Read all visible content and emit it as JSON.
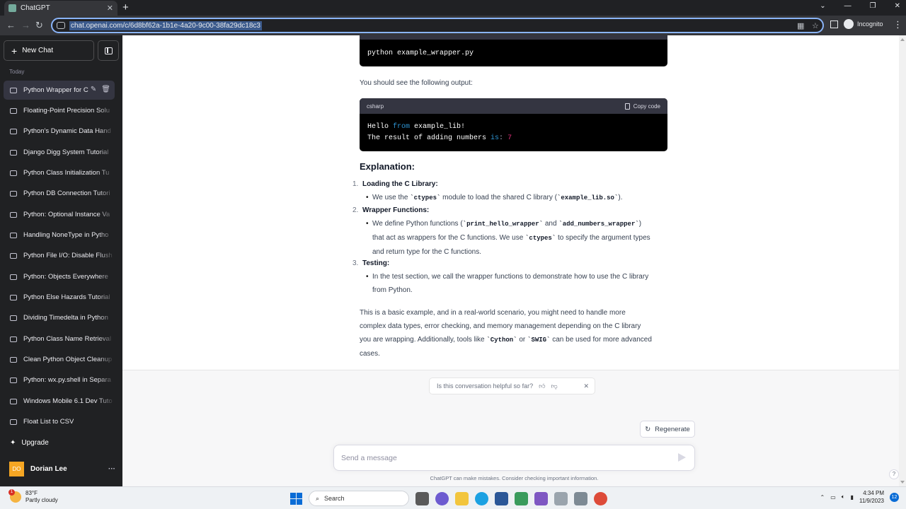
{
  "browser": {
    "tab_title": "ChatGPT",
    "url": "chat.openai.com/c/6d8bf62a-1b1e-4a20-9c00-38fa29dc18c3",
    "profile_label": "Incognito"
  },
  "sidebar": {
    "new_chat": "New Chat",
    "section_label": "Today",
    "conversations": [
      "Python Wrapper for C",
      "Floating-Point Precision Solu",
      "Python's Dynamic Data Hand",
      "Django Digg System Tutorial",
      "Python Class Initialization Tu",
      "Python DB Connection Tutori",
      "Python: Optional Instance Va",
      "Handling NoneType in Pytho",
      "Python File I/O: Disable Flush",
      "Python: Objects Everywhere",
      "Python Else Hazards Tutorial",
      "Dividing Timedelta in Python",
      "Python Class Name Retrieval",
      "Clean Python Object Cleanup",
      "Python: wx.py.shell in Separa",
      "Windows Mobile 6.1 Dev Tuto",
      "Float List to CSV"
    ],
    "upgrade": "Upgrade",
    "user_initials": "DO",
    "user_name": "Dorian Lee"
  },
  "content": {
    "run_command": "python example_wrapper.py",
    "output_intro": "You should see the following output:",
    "code_lang": "csharp",
    "copy_code": "Copy code",
    "output_line1": {
      "a": "Hello ",
      "b": "from",
      "c": " example_lib!"
    },
    "output_line2": {
      "a": "The result of adding numbers ",
      "b": "is",
      "c": ": ",
      "d": "7"
    },
    "heading": "Explanation:",
    "items": [
      {
        "num": "1.",
        "title": "Loading the C Library:"
      },
      {
        "num": "2.",
        "title": "Wrapper Functions:"
      },
      {
        "num": "3.",
        "title": "Testing:"
      }
    ],
    "item1_text": {
      "a": "We use the ",
      "code1": "`ctypes`",
      "b": " module to load the shared C library (",
      "code2": "`example_lib.so`",
      "c": ")."
    },
    "item2_text": {
      "a": "We define Python functions (",
      "code1": "`print_hello_wrapper`",
      "b": " and ",
      "code2": "`add_numbers_wrapper`",
      "c": ")",
      "d": "that act as wrappers for the C functions. We use ",
      "code3": "`ctypes`",
      "e": " to specify the argument types",
      "f": "and return type for the C functions."
    },
    "item3_text": {
      "a": "In the test section, we call the wrapper functions to demonstrate how to use the C library",
      "b": "from Python."
    },
    "summary": {
      "l1": "This is a basic example, and in a real-world scenario, you might need to handle more",
      "l2": "complex data types, error checking, and memory management depending on the C library",
      "l3a": "you are wrapping. Additionally, tools like ",
      "code1": "`Cython`",
      "l3b": " or ",
      "code2": "`SWIG`",
      "l3c": " can be used for more advanced",
      "l4": "cases."
    }
  },
  "footer": {
    "feedback_question": "Is this conversation helpful so far?",
    "regenerate": "Regenerate",
    "input_placeholder": "Send a message",
    "disclaimer": "ChatGPT can make mistakes. Consider checking important information.",
    "help": "?"
  },
  "taskbar": {
    "temperature": "83°F",
    "condition": "Partly cloudy",
    "weather_badge": "1",
    "search": "Search",
    "time": "4:34 PM",
    "date": "11/9/2023",
    "notifications": "12"
  }
}
